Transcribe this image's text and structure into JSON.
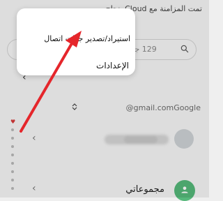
{
  "search": {
    "text": "129 جهة اتصا"
  },
  "cloud": {
    "text": "تمت المزامنة مع Cloud بنجاح"
  },
  "account": {
    "text": "@gmail.comGoogle"
  },
  "groups": {
    "label": "مجموعاتي"
  },
  "menu": {
    "items": [
      {
        "label": "استيراد/تصدير جهات اتصال"
      },
      {
        "label": "الإعدادات"
      }
    ]
  },
  "colors": {
    "arrow": "#e5262b",
    "accent_green": "#55b87a",
    "heart": "#d63a3a"
  },
  "icons": {
    "search": "search-icon",
    "chevron": "chevron-icon",
    "group": "people-icon"
  }
}
